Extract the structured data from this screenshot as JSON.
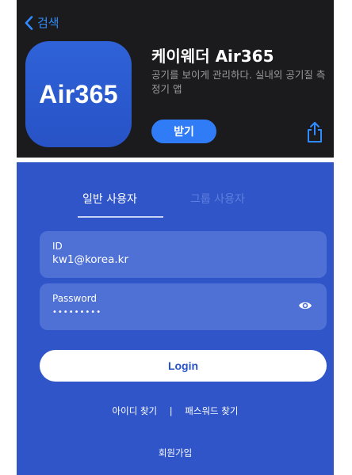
{
  "store": {
    "back_label": "검색",
    "app_icon_text": "Air365",
    "app_title": "케이웨더 Air365",
    "app_subtitle": "공기를 보이게 관리하다. 실내외 공기질 측정기 앱",
    "get_label": "받기",
    "icons": {
      "back": "chevron-left-icon",
      "share": "share-icon"
    },
    "colors": {
      "accent": "#2f7cf6",
      "background": "#1b1b1d",
      "icon_bg": "#2f62d8"
    }
  },
  "login": {
    "tabs": [
      {
        "label": "일반 사용자",
        "active": true
      },
      {
        "label": "그룹 사용자",
        "active": false
      }
    ],
    "id_label": "ID",
    "id_value": "kw1@korea.kr",
    "password_label": "Password",
    "password_value": "•••••••••",
    "login_label": "Login",
    "find_id": "아이디 찾기",
    "separator": "|",
    "find_password": "패스워드 찾기",
    "signup": "회원가입",
    "icons": {
      "toggle_password": "eye-icon"
    },
    "colors": {
      "background": "#2f55c9",
      "field": "#4f71d6",
      "button_text": "#2753c6"
    }
  }
}
